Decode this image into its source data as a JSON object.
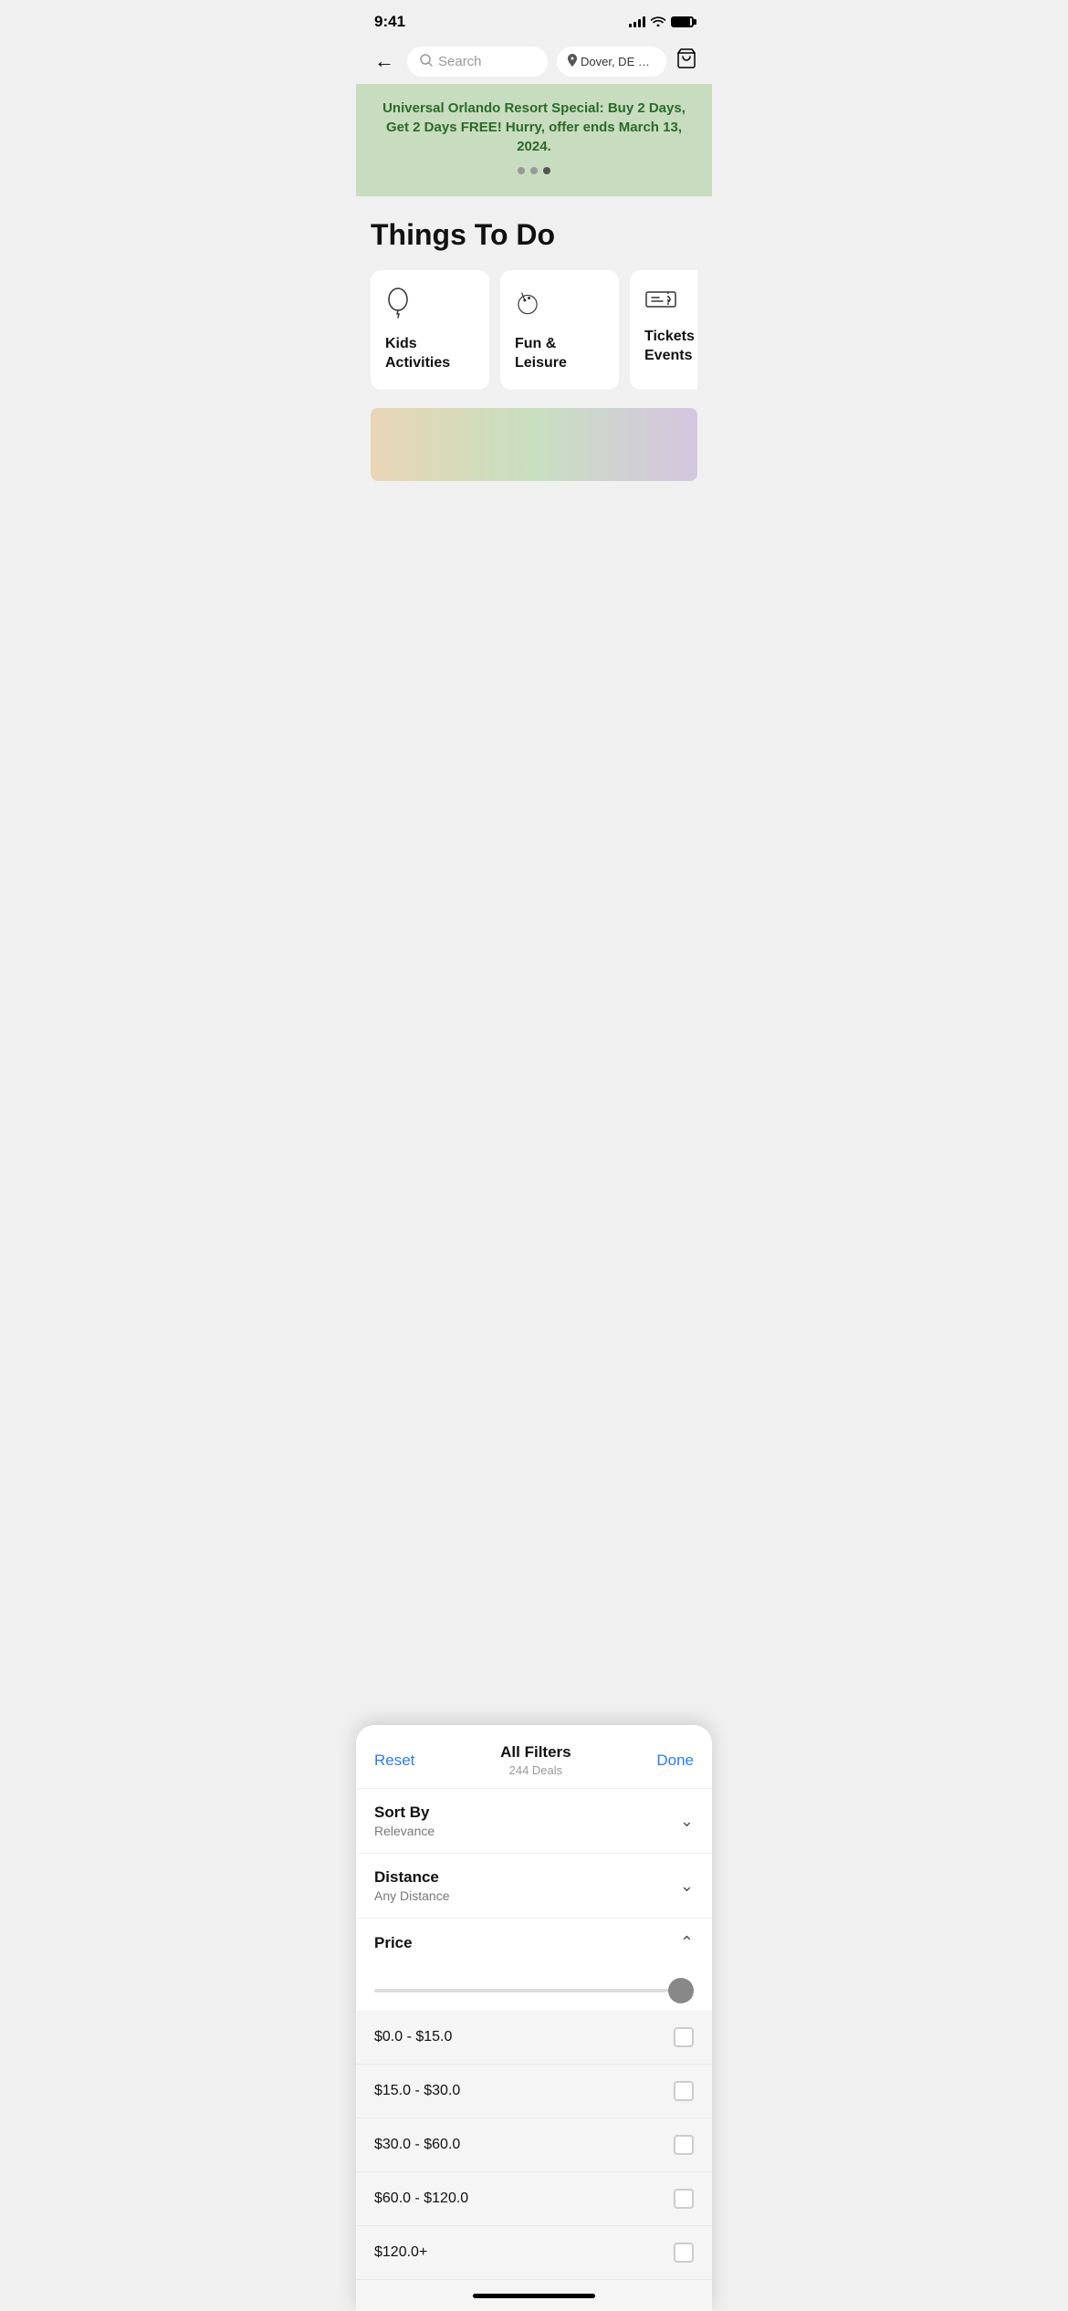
{
  "statusBar": {
    "time": "9:41"
  },
  "header": {
    "searchPlaceholder": "Search",
    "locationText": "Dover, DE 199...",
    "backLabel": "←",
    "cartLabel": "🛒"
  },
  "promoBanner": {
    "text": "Universal Orlando Resort Special: Buy 2 Days, Get 2 Days FREE! Hurry, offer ends March 13, 2024.",
    "dots": [
      {
        "active": false
      },
      {
        "active": false
      },
      {
        "active": true
      }
    ]
  },
  "page": {
    "title": "Things To Do"
  },
  "categories": [
    {
      "id": "kids",
      "label": "Kids Activities",
      "iconType": "balloon"
    },
    {
      "id": "fun",
      "label": "Fun & Leisure",
      "iconType": "bowling"
    },
    {
      "id": "tickets",
      "label": "Tickets & Events",
      "iconType": "ticket"
    }
  ],
  "filterSheet": {
    "resetLabel": "Reset",
    "title": "All Filters",
    "subtitle": "244 Deals",
    "doneLabel": "Done",
    "sortBy": {
      "label": "Sort By",
      "value": "Relevance"
    },
    "distance": {
      "label": "Distance",
      "value": "Any Distance"
    },
    "price": {
      "label": "Price",
      "options": [
        {
          "range": "$0.0 - $15.0"
        },
        {
          "range": "$15.0 - $30.0"
        },
        {
          "range": "$30.0 - $60.0"
        },
        {
          "range": "$60.0 - $120.0"
        },
        {
          "range": "$120.0+"
        }
      ]
    }
  },
  "homeIndicator": true
}
